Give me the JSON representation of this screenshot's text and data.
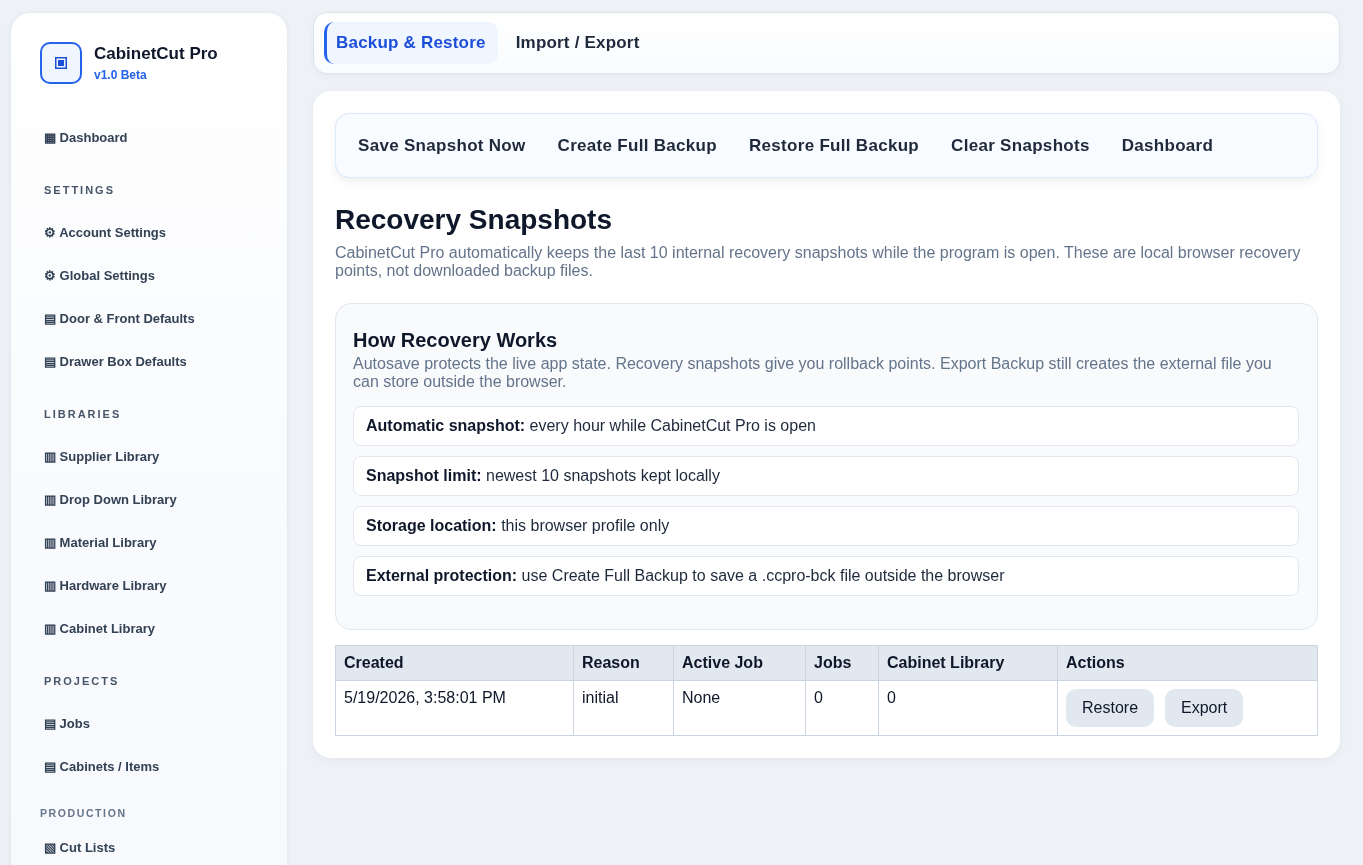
{
  "sidebar": {
    "brand": {
      "title": "CabinetCut Pro",
      "version": "v1.0 Beta"
    },
    "sections": [
      {
        "items": [
          {
            "label": "▦ Dashboard",
            "selected": false
          }
        ]
      },
      {
        "heading": "SETTINGS",
        "kind": "standard",
        "items": [
          {
            "label": "⚙ Account Settings",
            "selected": false
          },
          {
            "label": "⚙ Global Settings",
            "selected": false
          },
          {
            "label": "▤ Door & Front Defaults",
            "selected": false
          },
          {
            "label": "▤ Drawer Box Defaults",
            "selected": false
          }
        ]
      },
      {
        "heading": "LIBRARIES",
        "kind": "standard",
        "items": [
          {
            "label": "▥ Supplier Library",
            "selected": false
          },
          {
            "label": "▥ Drop Down Library",
            "selected": false
          },
          {
            "label": "▥ Material Library",
            "selected": false
          },
          {
            "label": "▥ Hardware Library",
            "selected": false
          },
          {
            "label": "▥ Cabinet Library",
            "selected": false
          }
        ]
      },
      {
        "heading": "PROJECTS",
        "kind": "standard",
        "items": [
          {
            "label": "▤ Jobs",
            "selected": false
          },
          {
            "label": "▤ Cabinets / Items",
            "selected": false
          }
        ]
      },
      {
        "heading": "PRODUCTION",
        "kind": "compact",
        "items": [
          {
            "label": "▧ Cut Lists",
            "selected": false
          }
        ]
      }
    ]
  },
  "tabs": [
    {
      "label": "Backup & Restore",
      "selected": true
    },
    {
      "label": "Import / Export",
      "selected": false
    }
  ],
  "toolbar": {
    "buttons": [
      "Save Snapshot Now",
      "Create Full Backup",
      "Restore Full Backup",
      "Clear Snapshots",
      "Dashboard"
    ]
  },
  "page": {
    "title": "Recovery Snapshots",
    "description": "CabinetCut Pro automatically keeps the last 10 internal recovery snapshots while the program is open. These are local browser recovery points, not downloaded backup files."
  },
  "info_card": {
    "title": "How Recovery Works",
    "description": "Autosave protects the live app state. Recovery snapshots give you rollback points. Export Backup still creates the external file you can store outside the browser.",
    "rows": [
      "**Automatic snapshot:** every hour while CabinetCut Pro is open",
      "**Snapshot limit:** newest 10 snapshots kept locally",
      "**Storage location:** this browser profile only",
      "**External protection:** use Create Full Backup to save a .ccpro-bck file outside the browser"
    ]
  },
  "table": {
    "columns": [
      "Created",
      "Reason",
      "Active Job",
      "Jobs",
      "Cabinet Library",
      "Actions"
    ],
    "rows": [
      {
        "cells": [
          "5/19/2026, 3:58:01 PM",
          "initial",
          "None",
          "0",
          "0"
        ],
        "actions": [
          "Restore",
          "Export"
        ]
      }
    ]
  }
}
